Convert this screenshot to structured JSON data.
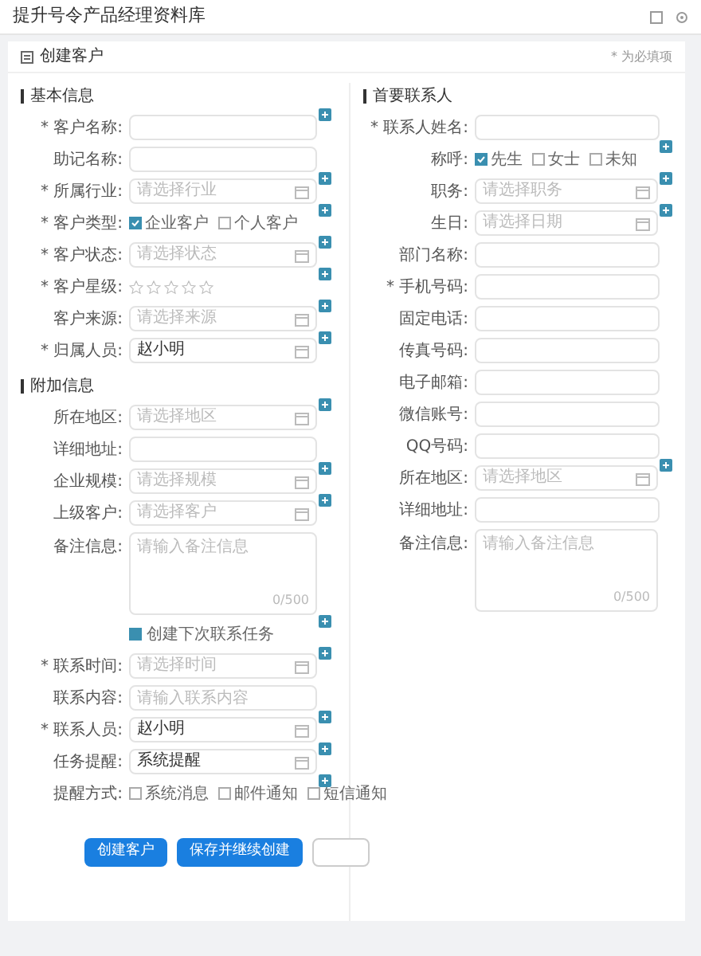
{
  "window": {
    "title": "提升号令产品经理资料库"
  },
  "card": {
    "title": "创建客户",
    "note": "* 为必填项"
  },
  "left_sections": [
    {
      "title": "基本信息",
      "fields": [
        {
          "kind": "text",
          "label": "* 客户名称:",
          "tip": true
        },
        {
          "kind": "text",
          "label": "助记名称:",
          "tip": false
        },
        {
          "kind": "select",
          "label": "* 所属行业:",
          "placeholder": "请选择行业",
          "tip": true
        },
        {
          "kind": "radio",
          "label": "* 客户类型:",
          "tip": true,
          "options": [
            {
              "label": "企业客户",
              "selected": true
            },
            {
              "label": "个人客户",
              "selected": false
            }
          ]
        },
        {
          "kind": "select",
          "label": "* 客户状态:",
          "placeholder": "请选择状态",
          "tip": true
        },
        {
          "kind": "stars",
          "label": "* 客户星级:",
          "stars": 0,
          "tip": true
        },
        {
          "kind": "select",
          "label": "客户来源:",
          "placeholder": "请选择来源",
          "tip": true
        },
        {
          "kind": "select",
          "label": "* 归属人员:",
          "value": "赵小明",
          "tip": true
        }
      ]
    },
    {
      "title": "附加信息",
      "fields": [
        {
          "kind": "select",
          "label": "所在地区:",
          "placeholder": "请选择地区",
          "tip": true
        },
        {
          "kind": "text",
          "label": "详细地址:",
          "tip": false
        },
        {
          "kind": "select",
          "label": "企业规模:",
          "placeholder": "请选择规模",
          "tip": true
        },
        {
          "kind": "select",
          "label": "上级客户:",
          "placeholder": "请选择客户",
          "tip": true
        },
        {
          "kind": "textarea",
          "label": "备注信息:",
          "placeholder": "请输入备注信息",
          "counter": "0/500",
          "tip": false
        },
        {
          "kind": "checkbox",
          "text": "创建下次联系任务",
          "checked": true,
          "tip": true
        },
        {
          "kind": "select",
          "label": "* 联系时间:",
          "placeholder": "请选择时间",
          "tip": true
        },
        {
          "kind": "text",
          "label": "联系内容:",
          "placeholder": "请输入联系内容",
          "tip": false
        },
        {
          "kind": "select",
          "label": "* 联系人员:",
          "value": "赵小明",
          "tip": true
        },
        {
          "kind": "select",
          "label": "任务提醒:",
          "value": "系统提醒",
          "tip": true
        },
        {
          "kind": "checks",
          "label": "提醒方式:",
          "tip": true,
          "options": [
            {
              "label": "系统消息",
              "selected": false
            },
            {
              "label": "邮件通知",
              "selected": false
            },
            {
              "label": "短信通知",
              "selected": false
            }
          ]
        }
      ]
    }
  ],
  "right_section": {
    "title": "首要联系人",
    "fields": [
      {
        "kind": "text",
        "label": "* 联系人姓名:",
        "tip": false
      },
      {
        "kind": "radio",
        "label": "称呼:",
        "tip": true,
        "options": [
          {
            "label": "先生",
            "selected": true
          },
          {
            "label": "女士",
            "selected": false
          },
          {
            "label": "未知",
            "selected": false
          }
        ]
      },
      {
        "kind": "select",
        "label": "职务:",
        "placeholder": "请选择职务",
        "tip": true
      },
      {
        "kind": "select",
        "label": "生日:",
        "placeholder": "请选择日期",
        "tip": true
      },
      {
        "kind": "text",
        "label": "部门名称:",
        "tip": false
      },
      {
        "kind": "text",
        "label": "* 手机号码:",
        "tip": false
      },
      {
        "kind": "text",
        "label": "固定电话:",
        "tip": false
      },
      {
        "kind": "text",
        "label": "传真号码:",
        "tip": false
      },
      {
        "kind": "text",
        "label": "电子邮箱:",
        "tip": false
      },
      {
        "kind": "text",
        "label": "微信账号:",
        "tip": false
      },
      {
        "kind": "text",
        "label": "QQ号码:",
        "tip": false
      },
      {
        "kind": "select",
        "label": "所在地区:",
        "placeholder": "请选择地区",
        "tip": true
      },
      {
        "kind": "text",
        "label": "详细地址:",
        "tip": false
      },
      {
        "kind": "textarea",
        "label": "备注信息:",
        "placeholder": "请输入备注信息",
        "counter": "0/500",
        "tip": false
      }
    ]
  },
  "buttons": [
    {
      "kind": "primary",
      "label": "创建客户"
    },
    {
      "kind": "primary",
      "label": "保存并继续创建"
    },
    {
      "kind": "outline"
    }
  ]
}
